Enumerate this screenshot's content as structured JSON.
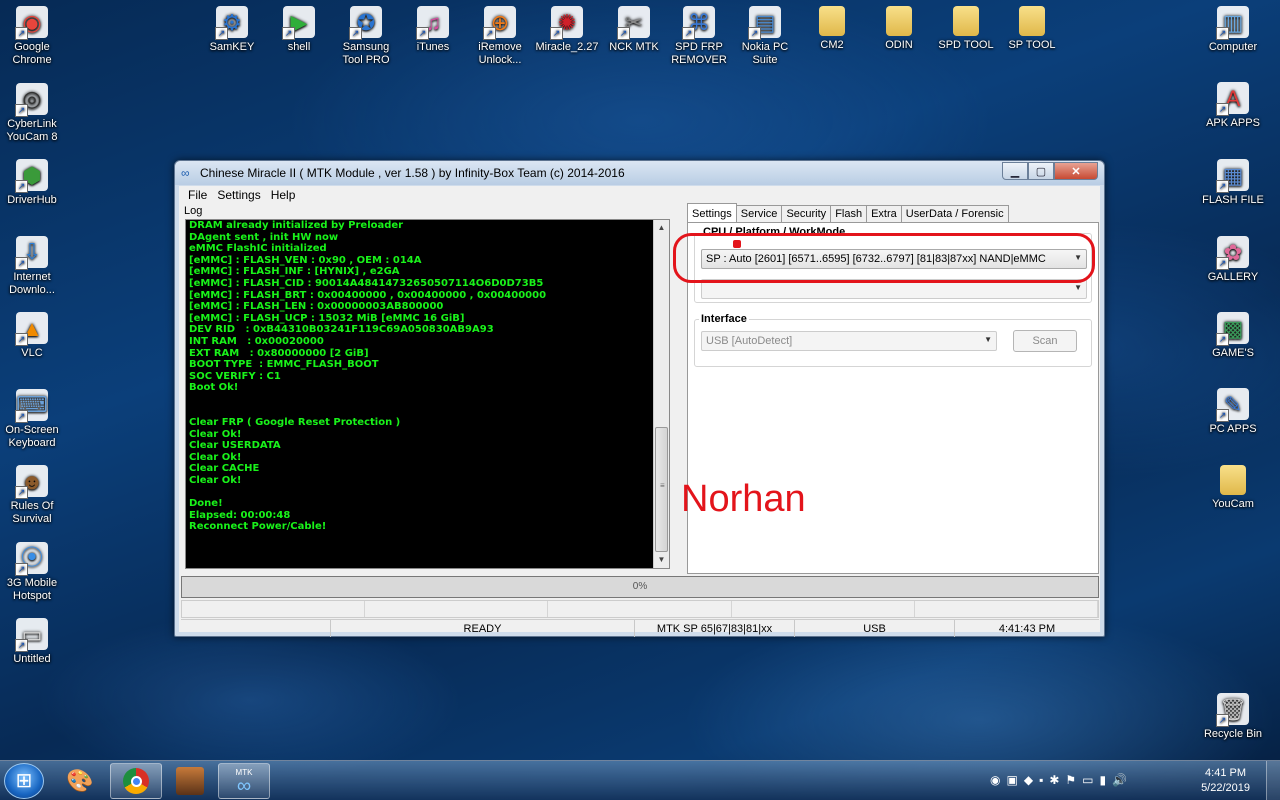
{
  "desktop": {
    "left_icons": [
      {
        "label": "Google\nChrome",
        "icon": "chrome-icon"
      },
      {
        "label": "CyberLink\nYouCam 8",
        "icon": "youcam-icon"
      },
      {
        "label": "DriverHub",
        "icon": "driverhub-icon"
      },
      {
        "label": "Internet\nDownlo...",
        "icon": "idm-icon"
      },
      {
        "label": "VLC",
        "icon": "vlc-icon"
      },
      {
        "label": "On-Screen\nKeyboard",
        "icon": "keyboard-icon"
      },
      {
        "label": "Rules Of\nSurvival",
        "icon": "game-icon"
      },
      {
        "label": "3G Mobile\nHotspot",
        "icon": "hotspot-icon"
      },
      {
        "label": "Untitled",
        "icon": "untitled-icon"
      }
    ],
    "top_icons": [
      {
        "label": "SamKEY",
        "icon": "samkey-icon"
      },
      {
        "label": "shell",
        "icon": "shell-icon"
      },
      {
        "label": "Samsung\nTool PRO",
        "icon": "samsung-tool-icon"
      },
      {
        "label": "iTunes",
        "icon": "itunes-icon"
      },
      {
        "label": "iRemove\nUnlock...",
        "icon": "iremove-icon"
      },
      {
        "label": "Miracle_2.27",
        "icon": "miracle-icon"
      },
      {
        "label": "NCK MTK",
        "icon": "nck-icon"
      },
      {
        "label": "SPD FRP\nREMOVER",
        "icon": "spd-frp-icon"
      },
      {
        "label": "Nokia PC\nSuite",
        "icon": "nokia-icon"
      },
      {
        "label": "CM2",
        "icon": "folder-icon"
      },
      {
        "label": "ODIN",
        "icon": "folder-icon"
      },
      {
        "label": "SPD TOOL",
        "icon": "folder-icon"
      },
      {
        "label": "SP TOOL",
        "icon": "folder-icon"
      }
    ],
    "right_icons": [
      {
        "label": "Computer",
        "icon": "computer-icon"
      },
      {
        "label": "APK APPS",
        "icon": "apk-icon"
      },
      {
        "label": "FLASH FILE",
        "icon": "flash-file-icon"
      },
      {
        "label": "GALLERY",
        "icon": "gallery-icon"
      },
      {
        "label": "GAME'S",
        "icon": "games-icon"
      },
      {
        "label": "PC APPS",
        "icon": "pc-apps-icon"
      },
      {
        "label": "YouCam",
        "icon": "folder-icon"
      },
      {
        "label": "Recycle Bin",
        "icon": "recycle-bin-icon"
      }
    ]
  },
  "window": {
    "title": "Chinese Miracle II ( MTK Module , ver 1.58 ) by Infinity-Box Team (c) 2014-2016",
    "menu": [
      "File",
      "Settings",
      "Help"
    ],
    "log_label": "Log",
    "log_lines": [
      "DRAM already initialized by Preloader",
      "DAgent sent , init HW now",
      "eMMC FlashIC initialized",
      "[eMMC] : FLASH_VEN : 0x90 , OEM : 014A",
      "[eMMC] : FLASH_INF : [HYNIX] , e2GA",
      "[eMMC] : FLASH_CID : 90014A48414732650507114O6D0D73B5",
      "[eMMC] : FLASH_BRT : 0x00400000 , 0x00400000 , 0x00400000",
      "[eMMC] : FLASH_LEN : 0x00000003AB800000",
      "[eMMC] : FLASH_UCP : 15032 MiB [eMMC 16 GiB]",
      "DEV RID   : 0xB44310B03241F119C69A050830AB9A93",
      "INT RAM   : 0x00020000",
      "EXT RAM   : 0x80000000 [2 GiB]",
      "BOOT TYPE  : EMMC_FLASH_BOOT",
      "SOC VERIFY : C1",
      "Boot Ok!",
      "",
      "",
      "Clear FRP ( Google Reset Protection )",
      "Clear Ok!",
      "Clear USERDATA",
      "Clear Ok!",
      "Clear CACHE",
      "Clear Ok!",
      "",
      "Done!",
      "Elapsed: 00:00:48",
      "Reconnect Power/Cable!"
    ],
    "tabs": [
      "Settings",
      "Service",
      "Security",
      "Flash",
      "Extra",
      "UserData / Forensic"
    ],
    "active_tab": "Settings",
    "cpu_group_label": "CPU / Platform / WorkMode",
    "cpu_select_value": "SP : Auto [2601] [6571..6595] [6732..6797] [81|83|87xx]  NAND|eMMC",
    "second_select_value": "",
    "interface_label": "Interface",
    "interface_select_value": "USB [AutoDetect]",
    "scan_button": "Scan",
    "progress_text": "0%",
    "status": {
      "ready": "READY",
      "platform": "MTK SP 65|67|83|81|xx",
      "port": "USB",
      "time": "4:41:43 PM"
    }
  },
  "overlay_text": "Norhan",
  "taskbar": {
    "clock_time": "4:41 PM",
    "clock_date": "5/22/2019",
    "pinned": [
      "paint-icon",
      "chrome-icon",
      "game-icon",
      "mtk-icon"
    ],
    "mtk_label": "MTK"
  },
  "colors": {
    "log_text": "#19f31a",
    "annotation_red": "#e3141b"
  }
}
